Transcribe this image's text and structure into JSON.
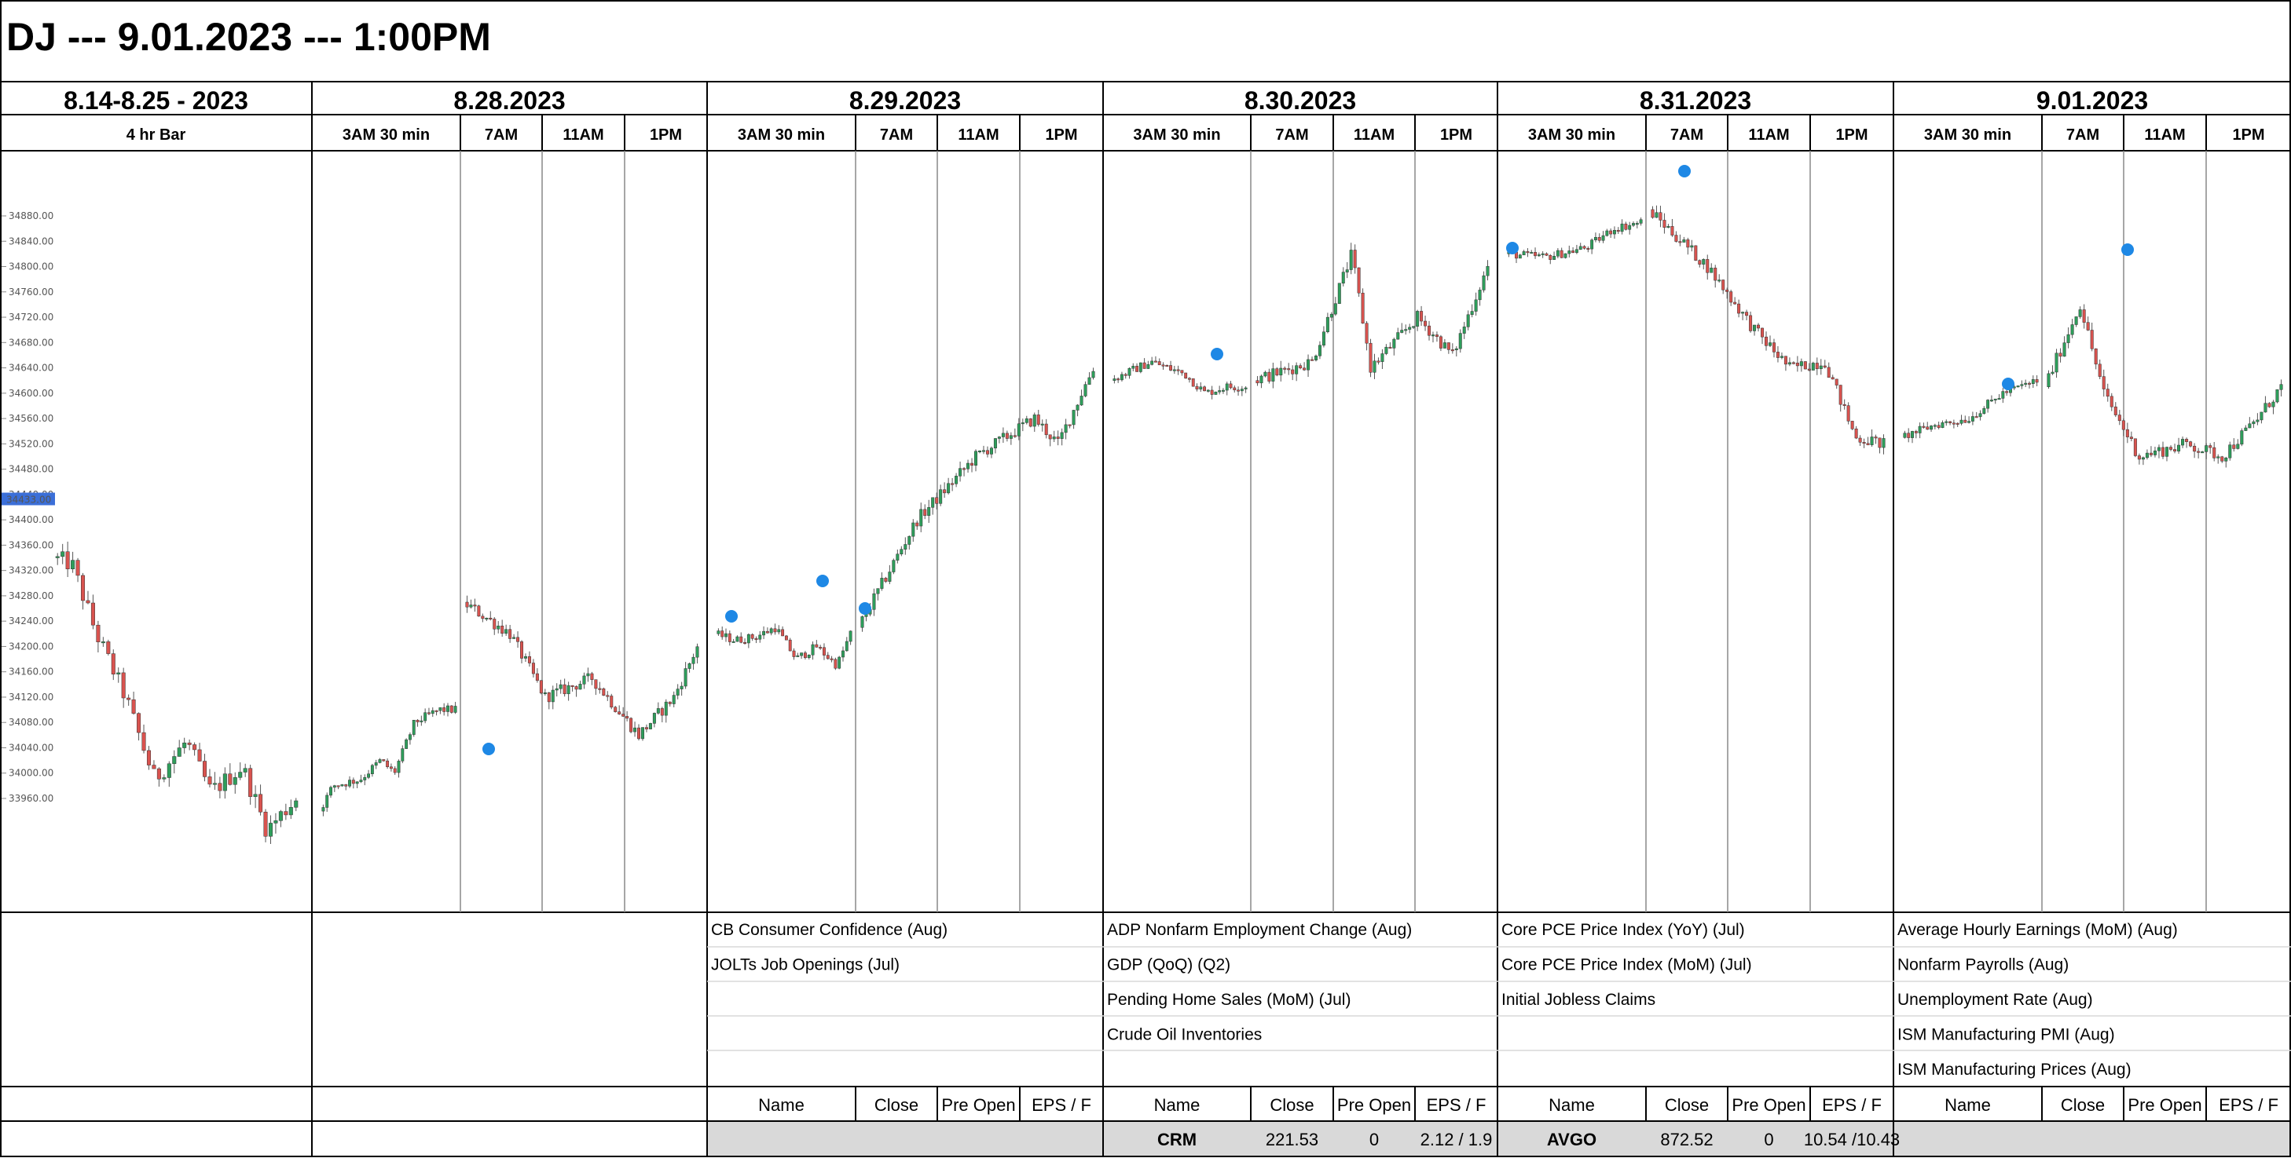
{
  "title": "DJ --- 9.01.2023 --- 1:00PM",
  "columns": [
    {
      "header": "8.14-8.25 - 2023",
      "subs": [
        "4 hr Bar"
      ]
    },
    {
      "header": "8.28.2023",
      "subs": [
        "3AM 30 min",
        "7AM",
        "11AM",
        "1PM"
      ]
    },
    {
      "header": "8.29.2023",
      "subs": [
        "3AM 30 min",
        "7AM",
        "11AM",
        "1PM"
      ]
    },
    {
      "header": "8.30.2023",
      "subs": [
        "3AM 30 min",
        "7AM",
        "11AM",
        "1PM"
      ]
    },
    {
      "header": "8.31.2023",
      "subs": [
        "3AM 30 min",
        "7AM",
        "11AM",
        "1PM"
      ]
    },
    {
      "header": "9.01.2023",
      "subs": [
        "3AM 30 min",
        "7AM",
        "11AM",
        "1PM"
      ]
    }
  ],
  "events": [
    [],
    [],
    [
      "CB Consumer Confidence (Aug)",
      "JOLTs Job Openings (Jul)"
    ],
    [
      "ADP Nonfarm Employment Change (Aug)",
      "GDP (QoQ) (Q2)",
      "Pending Home Sales (MoM) (Jul)",
      "Crude Oil Inventories"
    ],
    [
      "Core PCE Price Index (YoY) (Jul)",
      "Core PCE Price Index (MoM) (Jul)",
      "Initial Jobless Claims"
    ],
    [
      "Average Hourly Earnings (MoM) (Aug)",
      "Nonfarm Payrolls (Aug)",
      "Unemployment Rate (Aug)",
      "ISM Manufacturing PMI (Aug)",
      "ISM Manufacturing Prices (Aug)"
    ]
  ],
  "earnings_headers": [
    "Name",
    "Close",
    "Pre Open",
    "EPS / F"
  ],
  "earnings": [
    null,
    null,
    {
      "name": "",
      "close": "",
      "pre_open": "",
      "eps": ""
    },
    {
      "name": "CRM",
      "close": "221.53",
      "pre_open": "0",
      "eps": "2.12 / 1.9"
    },
    {
      "name": "AVGO",
      "close": "872.52",
      "pre_open": "0",
      "eps": "10.54 /10.43"
    },
    {
      "name": "",
      "close": "",
      "pre_open": "",
      "eps": ""
    }
  ],
  "colors": {
    "up": "#2e9e5b",
    "down": "#d9534f",
    "marker": "#1e88e5",
    "price_tag": "#3b6fd8",
    "table_fill": "#d9d9d9"
  },
  "chart_data": {
    "type": "candlestick",
    "y_ticks": [
      33960,
      34000,
      34040,
      34080,
      34120,
      34160,
      34200,
      34240,
      34280,
      34320,
      34360,
      34400,
      34440,
      34480,
      34520,
      34560,
      34600,
      34640,
      34680,
      34720,
      34760,
      34800,
      34840,
      34880
    ],
    "y_tick_labels": [
      "33960.00",
      "34000.00",
      "34040.00",
      "34080.00",
      "34120.00",
      "34160.00",
      "34200.00",
      "34240.00",
      "34280.00",
      "34320.00",
      "34360.00",
      "34400.00",
      "34440.00",
      "34480.00",
      "34520.00",
      "34560.00",
      "34600.00",
      "34640.00",
      "34680.00",
      "34720.00",
      "34760.00",
      "34800.00",
      "34840.00",
      "34880.00"
    ],
    "current_price": "34433.00",
    "ylim": [
      33910,
      34980
    ],
    "series": [
      {
        "name": "8.14-8.25 - 2023",
        "anchors": [
          [
            0,
            34340
          ],
          [
            0.08,
            34330
          ],
          [
            0.18,
            34220
          ],
          [
            0.3,
            34120
          ],
          [
            0.42,
            33990
          ],
          [
            0.55,
            34050
          ],
          [
            0.65,
            33970
          ],
          [
            0.78,
            34010
          ],
          [
            0.88,
            33910
          ],
          [
            1,
            33960
          ]
        ]
      },
      {
        "name": "8.28.2023",
        "anchors": [
          [
            0,
            33940
          ],
          [
            0.1,
            33980
          ],
          [
            0.3,
            33990
          ],
          [
            0.45,
            34020
          ],
          [
            0.55,
            34000
          ],
          [
            0.7,
            34080
          ],
          [
            0.88,
            34100
          ],
          [
            1,
            34100
          ]
        ],
        "anchors2": [
          [
            0,
            34270
          ],
          [
            0.2,
            34220
          ],
          [
            0.35,
            34120
          ],
          [
            0.55,
            34150
          ],
          [
            0.75,
            34060
          ],
          [
            0.9,
            34120
          ],
          [
            1,
            34200
          ]
        ]
      },
      {
        "name": "8.29.2023",
        "anchors": [
          [
            0,
            34220
          ],
          [
            0.15,
            34210
          ],
          [
            0.3,
            34215
          ],
          [
            0.45,
            34230
          ],
          [
            0.6,
            34180
          ],
          [
            0.75,
            34200
          ],
          [
            0.9,
            34170
          ],
          [
            1,
            34220
          ]
        ],
        "anchors2": [
          [
            0,
            34230
          ],
          [
            0.25,
            34400
          ],
          [
            0.5,
            34500
          ],
          [
            0.75,
            34560
          ],
          [
            0.85,
            34520
          ],
          [
            1,
            34640
          ]
        ]
      },
      {
        "name": "8.30.2023",
        "anchors": [
          [
            0,
            34620
          ],
          [
            0.3,
            34650
          ],
          [
            0.55,
            34630
          ],
          [
            0.7,
            34600
          ],
          [
            0.85,
            34610
          ],
          [
            1,
            34610
          ]
        ],
        "anchors2": [
          [
            0,
            34620
          ],
          [
            0.25,
            34650
          ],
          [
            0.42,
            34820
          ],
          [
            0.5,
            34640
          ],
          [
            0.7,
            34720
          ],
          [
            0.85,
            34660
          ],
          [
            1,
            34800
          ]
        ]
      },
      {
        "name": "8.31.2023",
        "anchors": [
          [
            0,
            34820
          ],
          [
            0.3,
            34815
          ],
          [
            0.6,
            34830
          ],
          [
            0.8,
            34860
          ],
          [
            1,
            34870
          ]
        ],
        "anchors2": [
          [
            0,
            34890
          ],
          [
            0.25,
            34800
          ],
          [
            0.45,
            34700
          ],
          [
            0.6,
            34640
          ],
          [
            0.75,
            34650
          ],
          [
            0.88,
            34530
          ],
          [
            1,
            34520
          ]
        ]
      },
      {
        "name": "9.01.2023",
        "anchors": [
          [
            0,
            34530
          ],
          [
            0.25,
            34550
          ],
          [
            0.5,
            34560
          ],
          [
            0.75,
            34600
          ],
          [
            1,
            34620
          ]
        ],
        "anchors2": [
          [
            0,
            34610
          ],
          [
            0.15,
            34740
          ],
          [
            0.25,
            34600
          ],
          [
            0.4,
            34500
          ],
          [
            0.6,
            34520
          ],
          [
            0.75,
            34500
          ],
          [
            0.9,
            34560
          ],
          [
            1,
            34610
          ]
        ]
      }
    ]
  }
}
